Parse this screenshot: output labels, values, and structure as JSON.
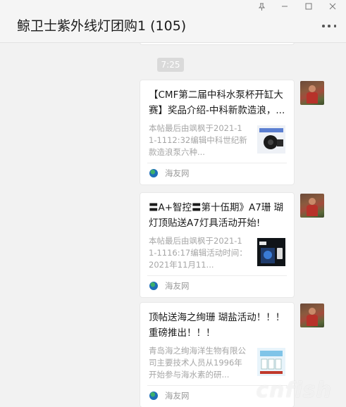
{
  "window": {
    "title": "鲸卫士紫外线灯团购1 (105)"
  },
  "chat": {
    "time_separator": "7:25",
    "messages": [
      {
        "title": "【CMF第二届中科水泵杯开缸大赛】奖品介绍-中科新款造浪，...",
        "description": "本帖最后由飒枫于2021-11-1112:32编辑中科世纪新款造浪泵六种...",
        "source": "海友网"
      },
      {
        "title": "〓A+智控〓第十伍期》A7珊 瑚灯顶贴送A7灯具活动开始!",
        "description": "本帖最后由飒枫于2021-11-1116:17编辑活动时间：2021年11月11...",
        "source": "海友网"
      },
      {
        "title": "顶帖送海之绚珊 瑚盐活动！！！重磅推出！！！",
        "description": "青岛海之绚海洋生物有限公司主要技术人员从1996年开始参与海水素的研...",
        "source": "海友网"
      }
    ]
  },
  "watermark": "cnfish",
  "colors": {
    "background": "#f2f2f2",
    "card": "#ffffff",
    "time_badge": "#dadada"
  }
}
